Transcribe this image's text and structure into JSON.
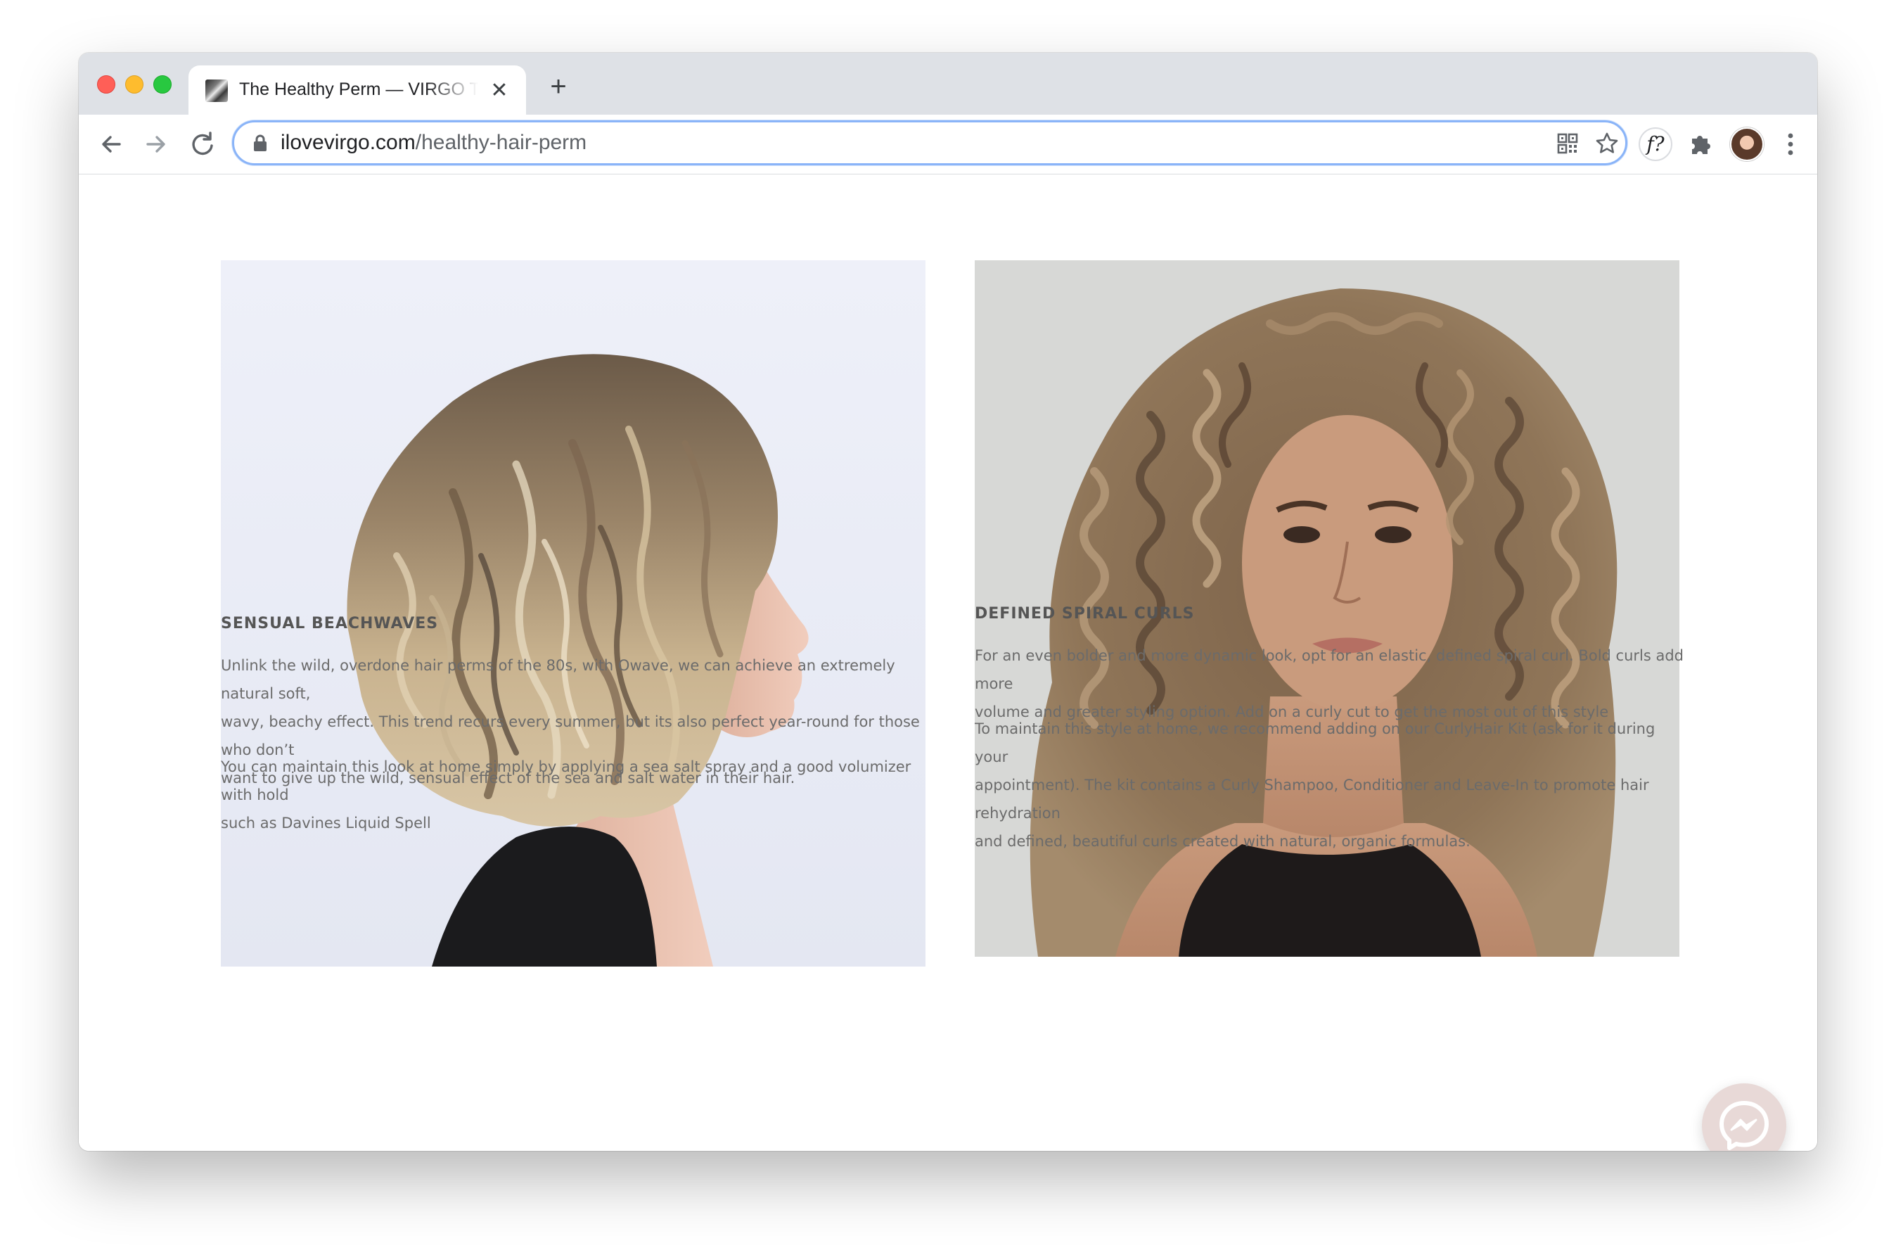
{
  "browser": {
    "tab": {
      "title": "The Healthy Perm — VIRGO TE",
      "favicon": "site-favicon"
    },
    "new_tab_label": "+",
    "close_tab_label": "✕",
    "address": {
      "host": "ilovevirgo.com",
      "path": "/healthy-hair-perm"
    },
    "icons": {
      "back": "back-arrow-icon",
      "forward": "forward-arrow-icon",
      "reload": "reload-icon",
      "lock": "lock-icon",
      "qr": "qr-code-icon",
      "star": "bookmark-star-icon",
      "font_ext": "font-extension-icon",
      "puzzle": "extensions-puzzle-icon",
      "avatar": "profile-avatar",
      "menu": "more-menu-icon"
    },
    "font_ext_label": "f?"
  },
  "sections": [
    {
      "title": "SENSUAL BEACHWAVES",
      "image": "woman-beachwaves-bob-photo",
      "paragraphs": [
        [
          "Unlink the wild, overdone hair perms of the 80s, with Owave, we can achieve an extremely natural soft,",
          "wavy, beachy effect. This trend recurs every summer, but its also perfect year-round for those who don’t",
          "want to give up the wild, sensual effect of the sea and salt water in their hair."
        ],
        [
          "You can maintain this look at home simply by applying a sea salt spray and a good volumizer with hold",
          "such as Davines Liquid Spell"
        ]
      ]
    },
    {
      "title": "DEFINED SPIRAL CURLS",
      "image": "woman-spiral-curls-photo",
      "paragraphs": [
        [
          "For an even bolder and more dynamic look, opt for an elastic, defined spiral curl. Bold curls add more",
          "volume and greater styling option. Add on a curly cut to get the most out of this style"
        ],
        [
          "To maintain this style at home, we recommend adding on our CurlyHair Kit (ask for it during your",
          "appointment). The kit contains a Curly Shampoo, Conditioner and Leave-In to promote hair rehydration",
          "and defined, beautiful curls created with natural, organic formulas."
        ]
      ]
    }
  ],
  "chat_widget": "messenger-icon",
  "colors": {
    "tabstrip": "#dee1e6",
    "omnibox_focus": "#8ab4f8",
    "heading_text": "#555555",
    "body_text": "#6b6b6b",
    "messenger_bubble": "#e8d9d7"
  }
}
